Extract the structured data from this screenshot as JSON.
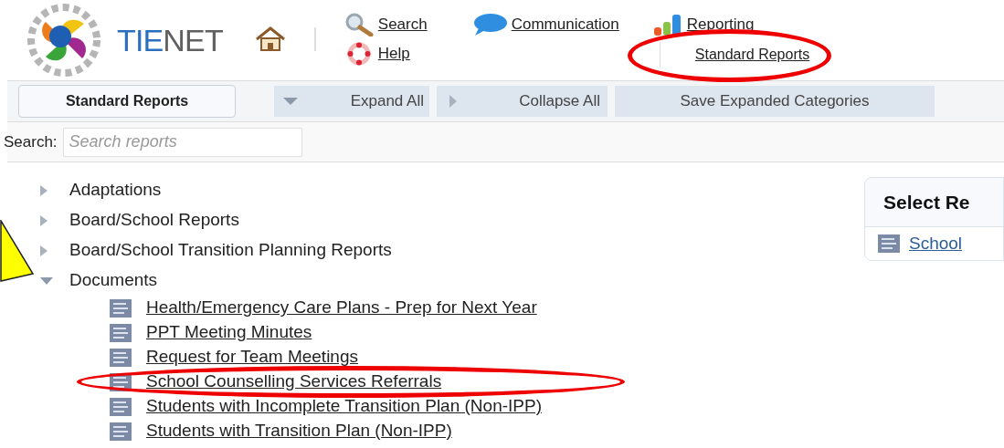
{
  "logo": {
    "text_1": "TIE",
    "text_2": "NET"
  },
  "nav": [
    {
      "kind": "search",
      "label": "Search",
      "sub": "Help",
      "highlighted": false
    },
    {
      "kind": "communication",
      "label": "Communication",
      "highlighted": false
    },
    {
      "kind": "reporting",
      "label": "Reporting",
      "sub": "Standard Reports",
      "highlighted": true
    }
  ],
  "toolbar": {
    "title_button": "Standard Reports",
    "buttons": [
      {
        "kind": "expand",
        "label": "Expand All"
      },
      {
        "kind": "collapse",
        "label": "Collapse All"
      },
      {
        "kind": "plain",
        "label": "Save Expanded Categories"
      }
    ]
  },
  "search": {
    "label": "Search:",
    "placeholder": "Search reports"
  },
  "tree": [
    {
      "label": "Adaptations",
      "expanded": false,
      "pointed": false
    },
    {
      "label": "Board/School Reports",
      "expanded": false,
      "pointed": false
    },
    {
      "label": "Board/School Transition Planning Reports",
      "expanded": false,
      "pointed": false
    },
    {
      "label": "Documents",
      "expanded": true,
      "pointed": true,
      "children": [
        {
          "label": "Health/Emergency Care Plans - Prep for Next Year",
          "highlighted": false
        },
        {
          "label": "PPT Meeting Minutes",
          "highlighted": false
        },
        {
          "label": "Request for Team Meetings",
          "highlighted": false
        },
        {
          "label": "School Counselling Services Referrals",
          "highlighted": true
        },
        {
          "label": "Students with Incomplete Transition Plan (Non-IPP)",
          "highlighted": false
        },
        {
          "label": "Students with Transition Plan (Non-IPP)",
          "highlighted": false
        }
      ]
    }
  ],
  "side_panel": {
    "title": "Select Re",
    "link": "School"
  }
}
